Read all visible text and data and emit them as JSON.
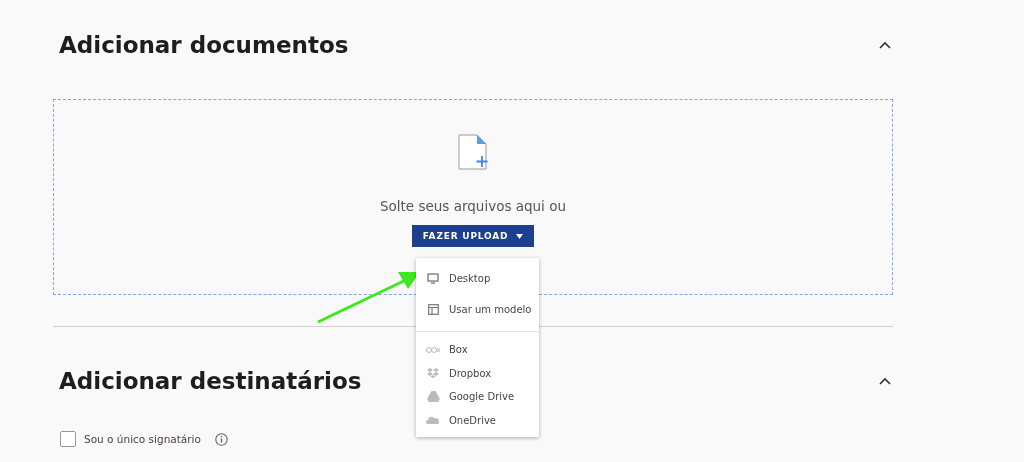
{
  "sections": [
    {
      "title": "Adicionar documentos",
      "expanded": true
    },
    {
      "title": "Adicionar destinatários",
      "expanded": true
    }
  ],
  "dropzone": {
    "text": "Solte seus arquivos aqui ou",
    "button": "FAZER UPLOAD"
  },
  "upload_menu": {
    "groups": [
      [
        {
          "label": "Desktop",
          "kind": "desktop"
        },
        {
          "label": "Usar um modelo",
          "kind": "template"
        }
      ],
      [
        {
          "label": "Box",
          "kind": "box"
        },
        {
          "label": "Dropbox",
          "kind": "dropbox"
        },
        {
          "label": "Google Drive",
          "kind": "gdrive"
        },
        {
          "label": "OneDrive",
          "kind": "onedrive"
        }
      ]
    ]
  },
  "only_signer": {
    "label": "Sou o único signatário",
    "checked": false
  }
}
